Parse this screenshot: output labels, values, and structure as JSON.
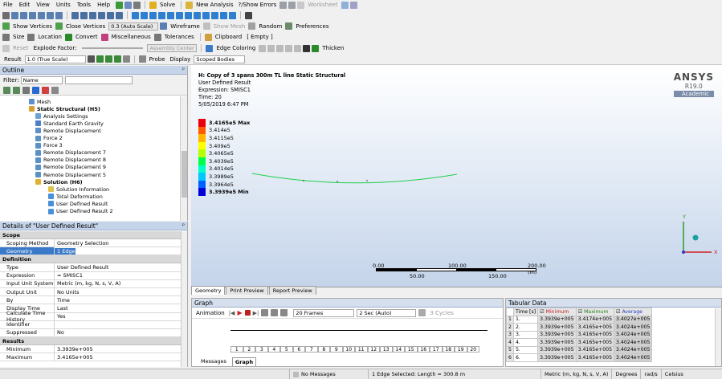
{
  "menu": [
    "File",
    "Edit",
    "View",
    "Units",
    "Tools",
    "Help"
  ],
  "toolbar1": {
    "solve": "Solve",
    "new_analysis": "New Analysis",
    "show_errors": "?/Show Errors",
    "worksheet": "Worksheet"
  },
  "toolbar2": {
    "show_vertices": "Show Vertices",
    "close_vertices": "Close Vertices",
    "auto_scale": "0.3 (Auto Scale)",
    "wireframe": "Wireframe",
    "show_mesh": "Show Mesh",
    "random": "Random",
    "preferences": "Preferences"
  },
  "toolbar3": {
    "size": "Size",
    "location": "Location",
    "convert": "Convert",
    "miscellaneous": "Miscellaneous",
    "tolerances": "Tolerances",
    "clipboard": "Clipboard",
    "clipboard_value": "[ Empty ]"
  },
  "toolbar4": {
    "reset": "Reset",
    "explode_factor": "Explode Factor:",
    "assembly_center": "Assembly Center",
    "edge_coloring": "Edge Coloring",
    "thicken": "Thicken"
  },
  "toolbar5": {
    "result_label": "Result",
    "result_value": "1.0 (True Scale)",
    "probe": "Probe",
    "display_label": "Display",
    "display_value": "Scoped Bodies"
  },
  "outline": {
    "title": "Outline",
    "filter_label": "Filter:",
    "filter_value": "Name",
    "items": [
      {
        "label": "Mesh",
        "indent": 1,
        "bold": false,
        "color": "#5b8fcf"
      },
      {
        "label": "Static Structural (H5)",
        "indent": 1,
        "bold": true,
        "color": "#d9a030"
      },
      {
        "label": "Analysis Settings",
        "indent": 2,
        "bold": false,
        "color": "#6a9fd8"
      },
      {
        "label": "Standard Earth Gravity",
        "indent": 2,
        "bold": false,
        "color": "#4a7fc8"
      },
      {
        "label": "Remote Displacement",
        "indent": 2,
        "bold": false,
        "color": "#5a8fc8"
      },
      {
        "label": "Force 2",
        "indent": 2,
        "bold": false,
        "color": "#5a8fc8"
      },
      {
        "label": "Force 3",
        "indent": 2,
        "bold": false,
        "color": "#5a8fc8"
      },
      {
        "label": "Remote Displacement 7",
        "indent": 2,
        "bold": false,
        "color": "#5a8fc8"
      },
      {
        "label": "Remote Displacement 8",
        "indent": 2,
        "bold": false,
        "color": "#5a8fc8"
      },
      {
        "label": "Remote Displacement 9",
        "indent": 2,
        "bold": false,
        "color": "#5a8fc8"
      },
      {
        "label": "Remote Displacement 5",
        "indent": 2,
        "bold": false,
        "color": "#5a8fc8"
      },
      {
        "label": "Solution (H6)",
        "indent": 2,
        "bold": true,
        "color": "#e0b030"
      },
      {
        "label": "Solution Information",
        "indent": 3,
        "bold": false,
        "color": "#e0c050"
      },
      {
        "label": "Total Deformation",
        "indent": 3,
        "bold": false,
        "color": "#4a90d8"
      },
      {
        "label": "User Defined Result",
        "indent": 3,
        "bold": false,
        "color": "#4a90d8"
      },
      {
        "label": "User Defined Result 2",
        "indent": 3,
        "bold": false,
        "color": "#4a90d8"
      }
    ]
  },
  "details": {
    "title": "Details of \"User Defined Result\"",
    "sections": [
      {
        "name": "Scope",
        "rows": [
          [
            "Scoping Method",
            "Geometry Selection"
          ],
          [
            "Geometry",
            "1 Edge"
          ]
        ]
      },
      {
        "name": "Definition",
        "rows": [
          [
            "Type",
            "User Defined Result"
          ],
          [
            "Expression",
            "= SMISC1"
          ],
          [
            "Input Unit System",
            "Metric (m, kg, N, s, V, A)"
          ],
          [
            "Output Unit",
            "No Units"
          ],
          [
            "By",
            "Time"
          ],
          [
            "Display Time",
            "Last"
          ],
          [
            "Calculate Time History",
            "Yes"
          ],
          [
            "Identifier",
            ""
          ],
          [
            "Suppressed",
            "No"
          ]
        ]
      },
      {
        "name": "Results",
        "rows": [
          [
            "Minimum",
            "3.3939e+005"
          ],
          [
            "Maximum",
            "3.4165e+005"
          ]
        ]
      }
    ]
  },
  "viewport": {
    "title": "H: Copy of 3 spans 300m TL line Static Structural",
    "line2": "User Defined Result",
    "line3": "Expression: SMISC1",
    "line4": "Time: 20",
    "line5": "5/05/2019 6:47 PM",
    "brand": "ANSYS",
    "version": "R19.0",
    "edition": "Academic",
    "legend": [
      "3.4165e5 Max",
      "3.414e5",
      "3.4115e5",
      "3.409e5",
      "3.4065e5",
      "3.4039e5",
      "3.4014e5",
      "3.3989e5",
      "3.3964e5",
      "3.3939e5 Min"
    ],
    "legend_colors": [
      "#e8000f",
      "#ff5a00",
      "#ffb400",
      "#ffff00",
      "#b4ff00",
      "#00ff4a",
      "#00ffc8",
      "#00c8ff",
      "#0060ff",
      "#0000d8"
    ],
    "scale_top": [
      "0.00",
      "100.00",
      "200.00 (m)"
    ],
    "scale_bottom": [
      "50.00",
      "150.00"
    ],
    "axis_y": "Y",
    "axis_x": "X"
  },
  "view_tabs": [
    "Geometry",
    "Print Preview",
    "Report Preview"
  ],
  "graph": {
    "title": "Graph",
    "animation": "Animation",
    "frames": "20 Frames",
    "duration": "2 Sec (Auto)",
    "cycles": "3 Cycles",
    "frame_numbers": [
      "1",
      "2",
      "3",
      "4",
      "5",
      "6",
      "7",
      "8",
      "9",
      "10",
      "11",
      "12",
      "13",
      "14",
      "15",
      "16",
      "17",
      "18",
      "19",
      "20"
    ],
    "bottom_tabs": [
      "Messages",
      "Graph"
    ]
  },
  "tabular": {
    "title": "Tabular Data",
    "headers": [
      "Time [s]",
      "Minimum",
      "Maximum",
      "Average"
    ],
    "rows": [
      [
        "1",
        "1.",
        "3.3939e+005",
        "3.4174e+005",
        "3.4027e+005"
      ],
      [
        "2",
        "2.",
        "3.3939e+005",
        "3.4165e+005",
        "3.4024e+005"
      ],
      [
        "3",
        "3.",
        "3.3939e+005",
        "3.4165e+005",
        "3.4024e+005"
      ],
      [
        "4",
        "4.",
        "3.3939e+005",
        "3.4165e+005",
        "3.4024e+005"
      ],
      [
        "5",
        "5.",
        "3.3939e+005",
        "3.4165e+005",
        "3.4024e+005"
      ],
      [
        "6",
        "6.",
        "3.3939e+005",
        "3.4165e+005",
        "3.4024e+005"
      ]
    ]
  },
  "status": {
    "messages": "No Messages",
    "selection": "1 Edge Selected: Length = 300.8 m",
    "units": "Metric (m, kg, N, s, V, A)",
    "degrees": "Degrees",
    "rads": "rad/s",
    "celsius": "Celsius"
  }
}
